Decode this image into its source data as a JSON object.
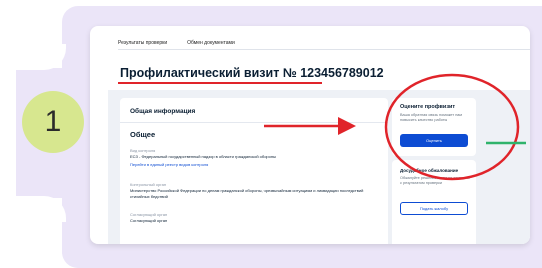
{
  "step": {
    "number": "1"
  },
  "tabs": [
    {
      "label": "Результаты проверки",
      "active": true
    },
    {
      "label": "Обмен документами",
      "active": false
    }
  ],
  "page_title": "Профилактический визит № 123456789012",
  "general": {
    "header": "Общая информация",
    "section_title": "Общее",
    "fields": [
      {
        "label": "Вид контроля",
        "value": "ЕСЗ - Федеральный государственный надзор в области гражданской обороны",
        "link": "Перейти в единый реестр видов контроля"
      },
      {
        "label": "Контрольный орган",
        "value": "Министерство Российской Федерации по делам гражданской обороны, чрезвычайным ситуациям и ликвидации последствий стихийных бедствий"
      },
      {
        "label": "Согласующий орган",
        "value": "Согласующий орган"
      }
    ]
  },
  "rate": {
    "title": "Оцените профвизит",
    "description": "Ваша обратная связь поможет нам повысить качество работы",
    "button": "Оценить"
  },
  "appeal": {
    "title": "Досудебное обжалование",
    "description": "Обжалуйте решение, если не согласны с результатом проверки",
    "button": "Подать жалобу"
  },
  "colors": {
    "accent": "#0d4cd3",
    "annotation_red": "#e0242a",
    "annotation_green": "#2fb36b",
    "lavender": "#ebe5f8",
    "step_circle": "#d7e78f"
  }
}
